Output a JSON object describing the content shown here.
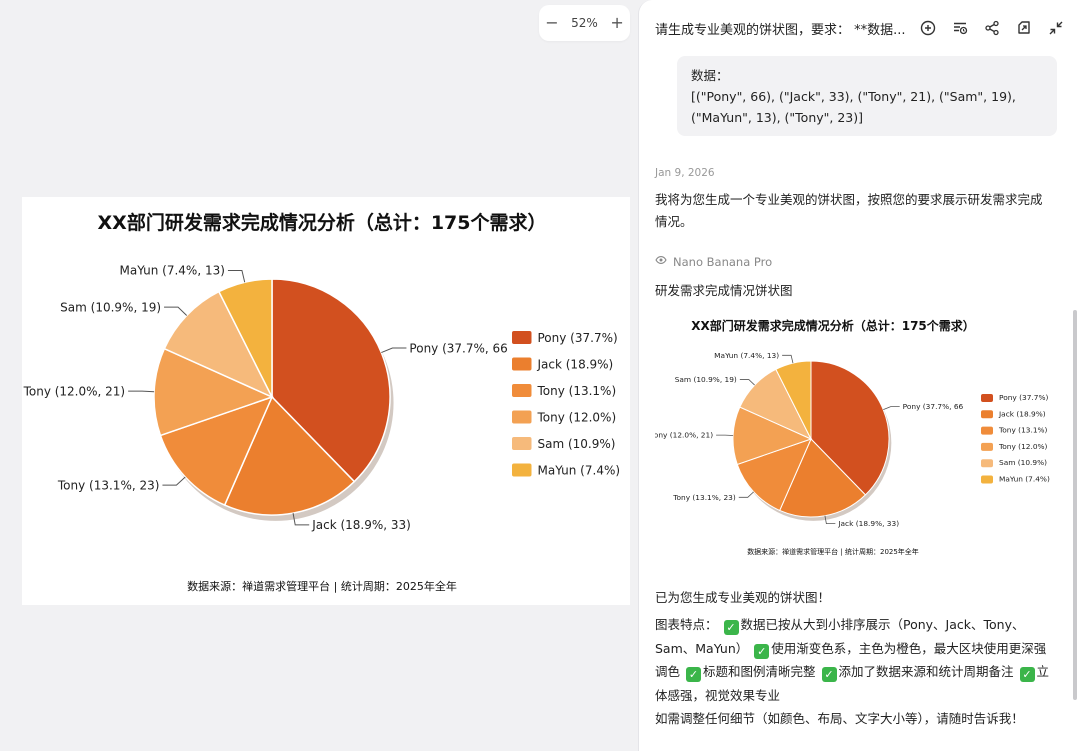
{
  "zoom": {
    "level": "52%",
    "minus": "−",
    "plus": "+"
  },
  "chart_data": {
    "type": "pie",
    "title": "XX部门研发需求完成情况分析（总计：175个需求）",
    "source": "数据来源：禅道需求管理平台 | 统计周期：2025年全年",
    "slices": [
      {
        "name": "Pony",
        "value": 66,
        "pct": 37.7,
        "color": "#d2501f",
        "outer_label": "Pony (37.7%, 66",
        "legend": "Pony (37.7%)"
      },
      {
        "name": "Jack",
        "value": 33,
        "pct": 18.9,
        "color": "#eb7f2e",
        "outer_label": "Jack (18.9%, 33)",
        "legend": "Jack (18.9%)"
      },
      {
        "name": "Tony",
        "value": 23,
        "pct": 13.1,
        "color": "#f08c3a",
        "outer_label": "Tony (13.1%, 23)",
        "legend": "Tony (13.1%)"
      },
      {
        "name": "Tony",
        "value": 21,
        "pct": 12.0,
        "color": "#f3a153",
        "outer_label": "Tony (12.0%, 21)",
        "legend": "Tony (12.0%)"
      },
      {
        "name": "Sam",
        "value": 19,
        "pct": 10.9,
        "color": "#f6ba7b",
        "outer_label": "Sam (10.9%, 19)",
        "legend": "Sam (10.9%)"
      },
      {
        "name": "MaYun",
        "value": 13,
        "pct": 7.4,
        "color": "#f3b23e",
        "outer_label": "MaYun (7.4%, 13)",
        "legend": "MaYun (7.4%)"
      }
    ],
    "legend_position": "right"
  },
  "panel": {
    "title": "请生成专业美观的饼状图，要求：  **数据...",
    "icons": [
      "add-chat-icon",
      "history-icon",
      "share-icon",
      "open-external-icon",
      "collapse-icon"
    ]
  },
  "user_message": {
    "line1": "数据：",
    "line2": "[(\"Pony\", 66), (\"Jack\", 33), (\"Tony\", 21), (\"Sam\", 19),",
    "line3": "(\"MaYun\", 13), (\"Tony\", 23)]"
  },
  "assistant": {
    "date": "Jan 9, 2026",
    "intro": "我将为您生成一个专业美观的饼状图，按照您的要求展示研发需求完成情况。",
    "model": "Nano Banana Pro",
    "image_title": "研发需求完成情况饼状图",
    "done": "已为您生成专业美观的饼状图！",
    "features_lead": "图表特点：",
    "features": [
      "数据已按从大到小排序展示（Pony、Jack、Tony、Sam、MaYun）",
      "使用渐变色系，主色为橙色，最大区块使用更深强调色",
      "标题和图例清晰完整",
      "添加了数据来源和统计周期备注",
      "立体感强，视觉效果专业"
    ],
    "followup": "如需调整任何细节（如颜色、布局、文字大小等），请随时告诉我！"
  },
  "colors": {
    "panel_bg": "#ffffff",
    "canvas_bg": "#f1f1f3",
    "check_green": "#3bb54a"
  }
}
